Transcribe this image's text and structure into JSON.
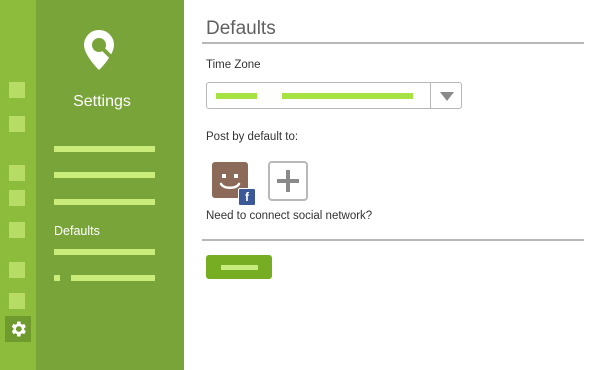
{
  "colors": {
    "rail": "#8dbb3c",
    "sidebar": "#79a43a",
    "accent": "#77ad22",
    "highlight": "#a6e241",
    "facebook": "#3b5998"
  },
  "icons": {
    "logo": "location-pin-icon",
    "rail_bottom": "gear-icon",
    "facebook_badge": "facebook-icon",
    "add": "plus-icon",
    "dropdown": "chevron-down-icon"
  },
  "sidebar": {
    "title": "Settings",
    "active_item": "Defaults"
  },
  "main": {
    "title": "Defaults",
    "timezone_label": "Time Zone",
    "post_default_label": "Post by default to:",
    "social_link": "Need to connect social network?",
    "facebook_badge_text": "f"
  }
}
